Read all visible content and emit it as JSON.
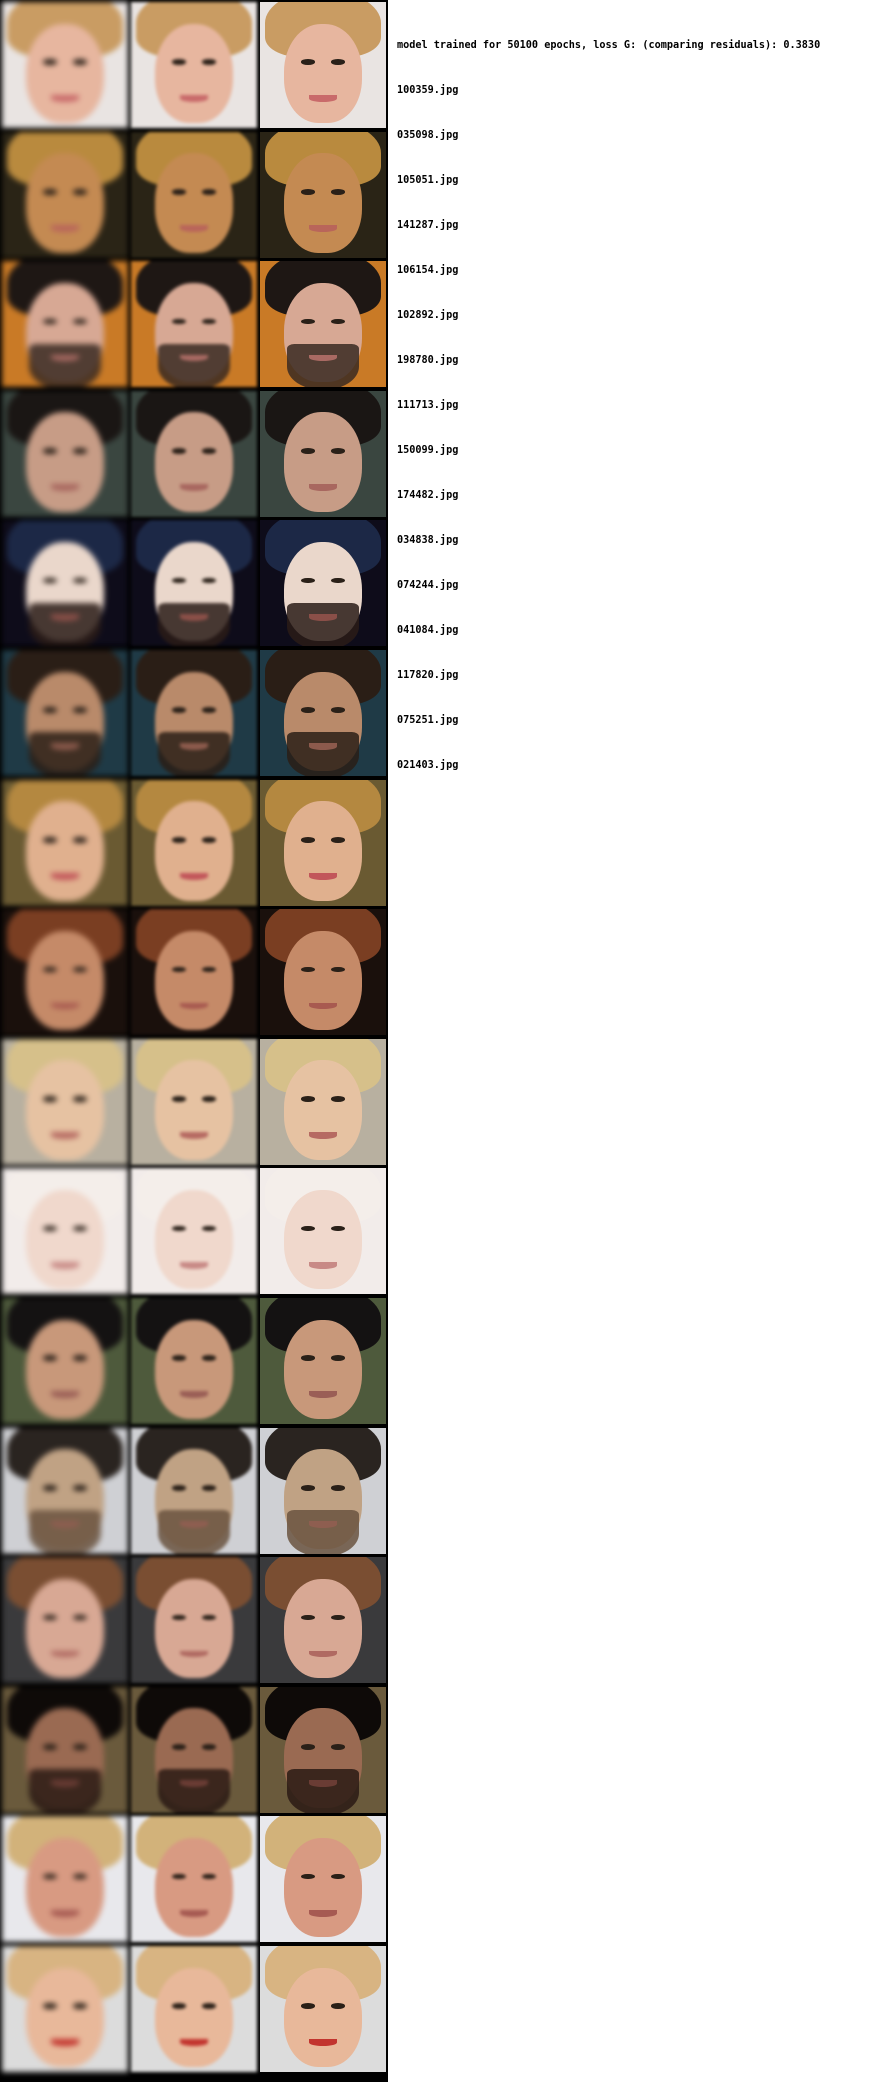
{
  "log": {
    "header": "model trained for 50100 epochs, loss G: (comparing residuals): 0.3830",
    "files": [
      "100359.jpg",
      "035098.jpg",
      "105051.jpg",
      "141287.jpg",
      "106154.jpg",
      "102892.jpg",
      "198780.jpg",
      "111713.jpg",
      "150099.jpg",
      "174482.jpg",
      "034838.jpg",
      "074244.jpg",
      "041084.jpg",
      "117820.jpg",
      "075251.jpg",
      "021403.jpg"
    ]
  },
  "rows": [
    {
      "bg": "#e9e4e2",
      "skin": "#e7b69f",
      "hair": "#c99c63",
      "lips": "#c96a6a"
    },
    {
      "bg": "#2a2416",
      "skin": "#c48a52",
      "hair": "#b98a3e",
      "lips": "#b9655a"
    },
    {
      "bg": "#c97a26",
      "skin": "#d7a894",
      "hair": "#1e1714",
      "lips": "#a96a63",
      "beard": "#3a2a22"
    },
    {
      "bg": "#3a4640",
      "skin": "#c79c86",
      "hair": "#1a1614",
      "lips": "#a8675f"
    },
    {
      "bg": "#0e0c1a",
      "skin": "#ead7cb",
      "hair": "#1c2846",
      "lips": "#8a4f48",
      "beard": "#2a1c18"
    },
    {
      "bg": "#1f3a46",
      "skin": "#b98a6a",
      "hair": "#2a1e16",
      "lips": "#8c5a4c",
      "beard": "#2a1e16"
    },
    {
      "bg": "#6a5a32",
      "skin": "#e0b08e",
      "hair": "#b48840",
      "lips": "#c2565a"
    },
    {
      "bg": "#1a100c",
      "skin": "#c58a68",
      "hair": "#7a3e22",
      "lips": "#a85a50"
    },
    {
      "bg": "#b8b0a0",
      "skin": "#e6c2a2",
      "hair": "#d6c08a",
      "lips": "#b66a62"
    },
    {
      "bg": "#f2ecea",
      "skin": "#f0d8cc",
      "hair": "#f4eeea",
      "lips": "#c88a86"
    },
    {
      "bg": "#4e5a3c",
      "skin": "#c8987a",
      "hair": "#141212",
      "lips": "#9a5e56"
    },
    {
      "bg": "#cfd0d4",
      "skin": "#c0a284",
      "hair": "#2a2420",
      "lips": "#8e5e50",
      "beard": "#6a5440"
    },
    {
      "bg": "#3a3a3c",
      "skin": "#d8a894",
      "hair": "#7a4e32",
      "lips": "#b06a62"
    },
    {
      "bg": "#6a5a3c",
      "skin": "#9a6a52",
      "hair": "#0e0a08",
      "lips": "#6a3c34",
      "beard": "#2a1a14"
    },
    {
      "bg": "#e8e8ec",
      "skin": "#d89a82",
      "hair": "#d2b27a",
      "lips": "#a65a52"
    },
    {
      "bg": "#dcdcdc",
      "skin": "#e8b89a",
      "hair": "#d8b482",
      "lips": "#c2342e"
    }
  ]
}
